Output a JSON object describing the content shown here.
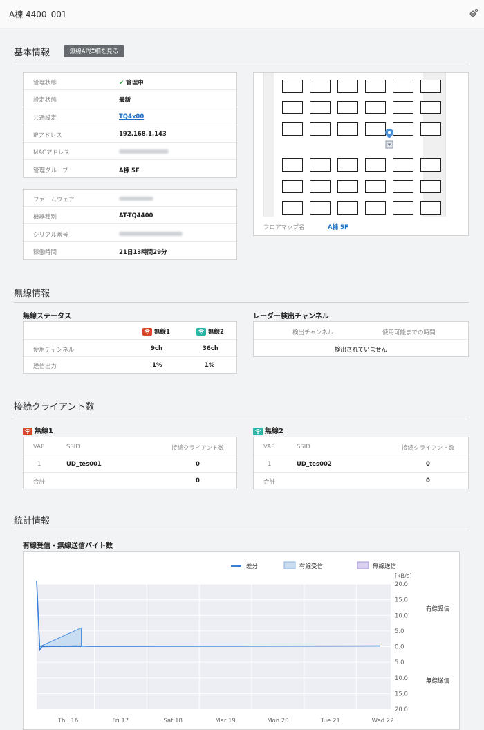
{
  "header": {
    "title": "A棟 4400_001",
    "settings_icon": "gear-icon"
  },
  "basic": {
    "section_title": "基本情報",
    "ap_detail_button": "無線AP詳細を見る",
    "status_rows": [
      {
        "key": "管理状態",
        "value": "管理中"
      },
      {
        "key": "設定状態",
        "value": "最新"
      },
      {
        "key": "共通設定",
        "value": "TQ4x00"
      },
      {
        "key": "IPアドレス",
        "value": "192.168.1.143"
      },
      {
        "key": "MACアドレス",
        "value": ""
      },
      {
        "key": "管理グループ",
        "value": "A棟 5F"
      }
    ],
    "device_rows": [
      {
        "key": "ファームウェア",
        "value": ""
      },
      {
        "key": "機器種別",
        "value": "AT-TQ4400"
      },
      {
        "key": "シリアル番号",
        "value": ""
      },
      {
        "key": "稼働時間",
        "value": "21日13時間29分"
      }
    ],
    "floor_map": {
      "label": "フロアマップ名",
      "value": "A棟 5F"
    }
  },
  "wireless": {
    "section_title": "無線情報",
    "status_title": "無線ステータス",
    "radio1": "無線1",
    "radio2": "無線2",
    "rows": [
      {
        "key": "使用チャンネル",
        "r1": "9ch",
        "r2": "36ch"
      },
      {
        "key": "送信出力",
        "r1": "1%",
        "r2": "1%"
      }
    ],
    "radar_title": "レーダー検出チャンネル",
    "radar_col1": "検出チャンネル",
    "radar_col2": "使用可能までの時間",
    "radar_empty": "検出されていません"
  },
  "clients": {
    "section_title": "接続クライアント数",
    "col_vap": "VAP",
    "col_ssid": "SSID",
    "col_count": "接続クライアント数",
    "total_label": "合計",
    "radio1": {
      "title": "無線1",
      "vap": "1",
      "ssid": "UD_tes001",
      "count": "0",
      "total": "0"
    },
    "radio2": {
      "title": "無線2",
      "vap": "1",
      "ssid": "UD_tes002",
      "count": "0",
      "total": "0"
    }
  },
  "stats": {
    "section_title": "統計情報",
    "chart_title": "有線受信・無線送信バイト数"
  },
  "chart_data": {
    "type": "line",
    "title": "有線受信・無線送信バイト数",
    "legend": [
      "差分",
      "有線受信",
      "無線送信"
    ],
    "legend_position": "top-right",
    "unit_label": "[kB/s]",
    "upper_label": "有線受信",
    "lower_label": "無線送信",
    "y_ticks": [
      "20.0",
      "15.0",
      "10.0",
      "5.0",
      "0.0",
      "5.0",
      "10.0",
      "15.0",
      "20.0"
    ],
    "ylim": [
      -20,
      20
    ],
    "x_ticks": [
      "Thu 16",
      "Fri 17",
      "Sat 18",
      "Mar 19",
      "Mon 20",
      "Tue 21",
      "Wed 22"
    ],
    "series": [
      {
        "name": "差分",
        "points": [
          [
            0,
            21
          ],
          [
            0.06,
            -1
          ],
          [
            0.1,
            0
          ],
          [
            0.75,
            0.2
          ],
          [
            1,
            0.1
          ],
          [
            6.55,
            0.2
          ]
        ]
      },
      {
        "name": "有線受信",
        "points": [
          [
            0.06,
            0
          ],
          [
            0.85,
            6
          ],
          [
            0.85,
            0
          ]
        ]
      }
    ],
    "colors": {
      "diff": "#3a7fd9",
      "wired": "#c9ddf2",
      "wireless": "#d9d0f2"
    },
    "grid": true
  }
}
